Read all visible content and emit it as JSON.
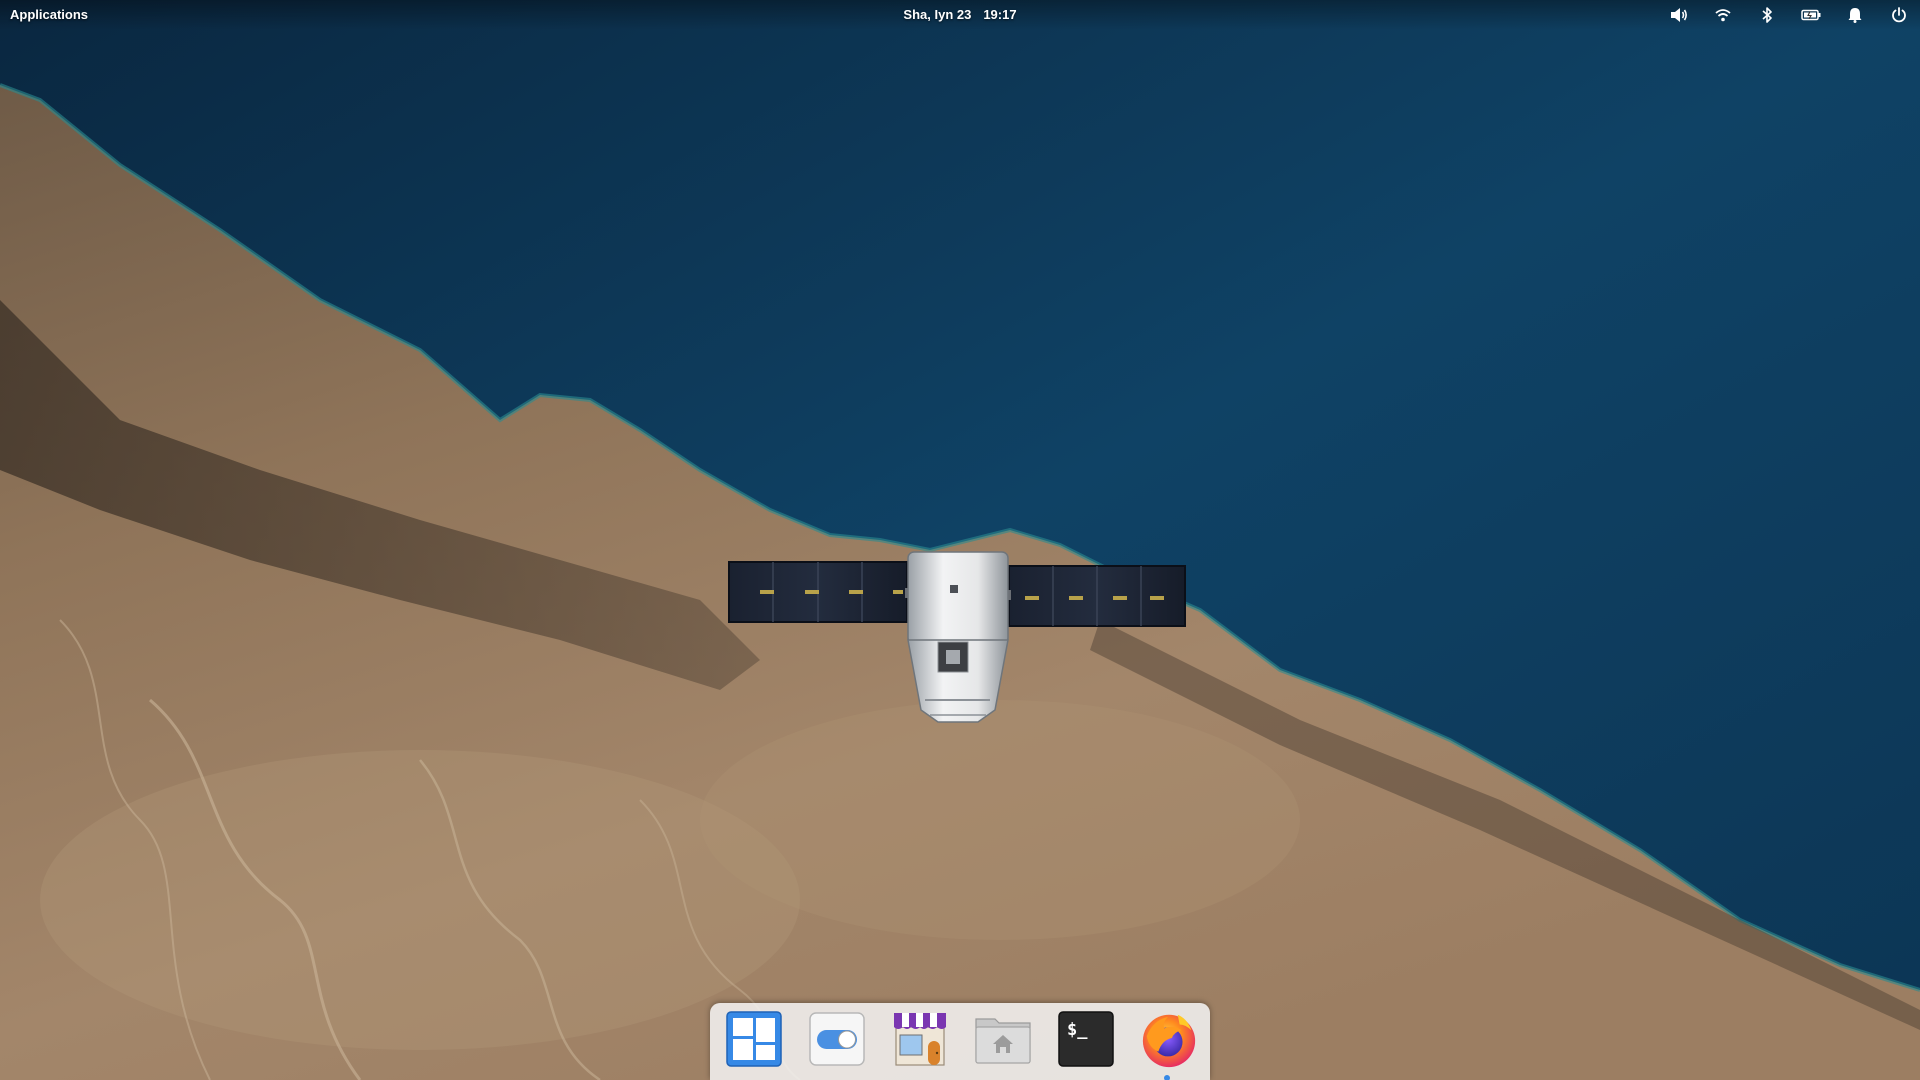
{
  "top_panel": {
    "applications_label": "Applications",
    "clock": {
      "date": "Sha, Iyn 23",
      "time": "19:17"
    },
    "indicators": [
      {
        "icon": "volume-icon"
      },
      {
        "icon": "wifi-icon"
      },
      {
        "icon": "bluetooth-icon"
      },
      {
        "icon": "battery-icon"
      },
      {
        "icon": "notifications-icon"
      },
      {
        "icon": "power-icon"
      }
    ]
  },
  "dock": {
    "items": [
      {
        "icon": "multitasking-view-icon"
      },
      {
        "icon": "system-settings-icon"
      },
      {
        "icon": "appcenter-icon"
      },
      {
        "icon": "files-icon"
      },
      {
        "icon": "terminal-icon",
        "glyph": "$_"
      },
      {
        "icon": "firefox-icon",
        "running": true
      }
    ]
  },
  "colors": {
    "panel_text": "#ffffff",
    "dock_background": "#f5f5f5",
    "running_indicator": "#3689e6",
    "sea": "#0e3a5c",
    "land": "#9c7e5f"
  }
}
